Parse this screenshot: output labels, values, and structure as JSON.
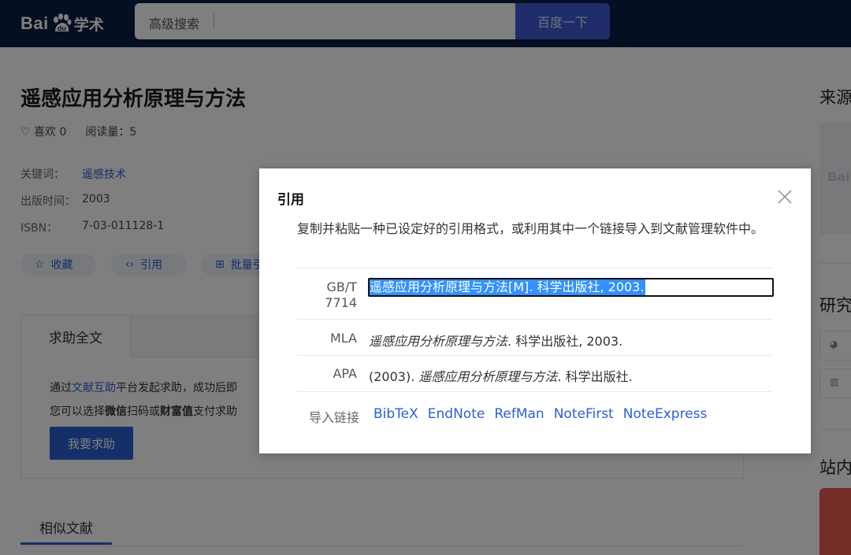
{
  "header": {
    "logo_text_bai": "Bai",
    "logo_text_xueshu": "学术",
    "search_placeholder": "高级搜索",
    "search_button": "百度一下"
  },
  "paper": {
    "title": "遥感应用分析原理与方法",
    "like_label": "♡ 喜欢 0",
    "read_label": "阅读量：5",
    "keywords_label": "关键词：",
    "keywords_value": "遥感技术",
    "pubdate_label": "出版时间：",
    "pubdate_value": "2003",
    "isbn_label": "ISBN：",
    "isbn_value": "7-03-011128-1"
  },
  "actions": {
    "collect": "收藏",
    "cite": "引用",
    "batch": "批量引"
  },
  "help": {
    "tab": "求助全文",
    "line1_prefix": "通过",
    "line1_link": "文献互助",
    "line1_suffix": "平台发起求助，成功后即",
    "line2_prefix": "您可以选择",
    "line2_bold1": "微信",
    "line2_mid1": "扫码或",
    "line2_bold2": "财富值",
    "line2_suffix": "支付求助",
    "button": "我要求助"
  },
  "similar": {
    "tab": "相似文献"
  },
  "sidebar": {
    "source_title": "来源",
    "research_title": "研究",
    "site_title": "站内"
  },
  "cite_modal": {
    "title": "引用",
    "description": "复制并粘贴一种已设定好的引用格式，或利用其中一个链接导入到文献管理软件中。",
    "gbt_label_1": "GB/T",
    "gbt_label_2": "7714",
    "gbt_text": "遥感应用分析原理与方法[M]. 科学出版社, 2003.",
    "mla_label": "MLA",
    "mla_italic": "遥感应用分析原理与方法",
    "mla_rest": ". 科学出版社, 2003.",
    "apa_label": "APA",
    "apa_prefix": "(2003). ",
    "apa_italic": "遥感应用分析原理与方法",
    "apa_rest": ". 科学出版社.",
    "import_label": "导入链接",
    "import_links": [
      "BibTeX",
      "EndNote",
      "RefMan",
      "NoteFirst",
      "NoteExpress"
    ]
  },
  "colors": {
    "header_bg": "#0b1f45",
    "accent": "#2a5fd3",
    "search_button_bg": "#3d5bd4",
    "selection": "#3390ff"
  }
}
